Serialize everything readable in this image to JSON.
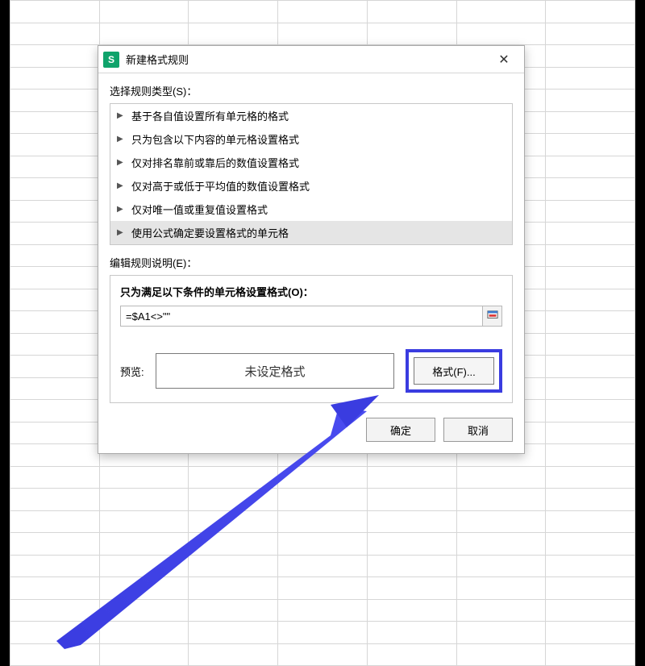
{
  "dialog": {
    "title": "新建格式规则",
    "close_glyph": "✕",
    "app_icon_letter": "S",
    "select_label": "选择规则类型(S)：",
    "rules": [
      "基于各自值设置所有单元格的格式",
      "只为包含以下内容的单元格设置格式",
      "仅对排名靠前或靠后的数值设置格式",
      "仅对高于或低于平均值的数值设置格式",
      "仅对唯一值或重复值设置格式",
      "使用公式确定要设置格式的单元格"
    ],
    "selected_rule_index": 5,
    "edit_label": "编辑规则说明(E)：",
    "condition_label": "只为满足以下条件的单元格设置格式(O)：",
    "formula_value": "=$A1<>\"\"",
    "preview_label": "预览:",
    "preview_text": "未设定格式",
    "format_button": "格式(F)...",
    "ok_button": "确定",
    "cancel_button": "取消"
  }
}
